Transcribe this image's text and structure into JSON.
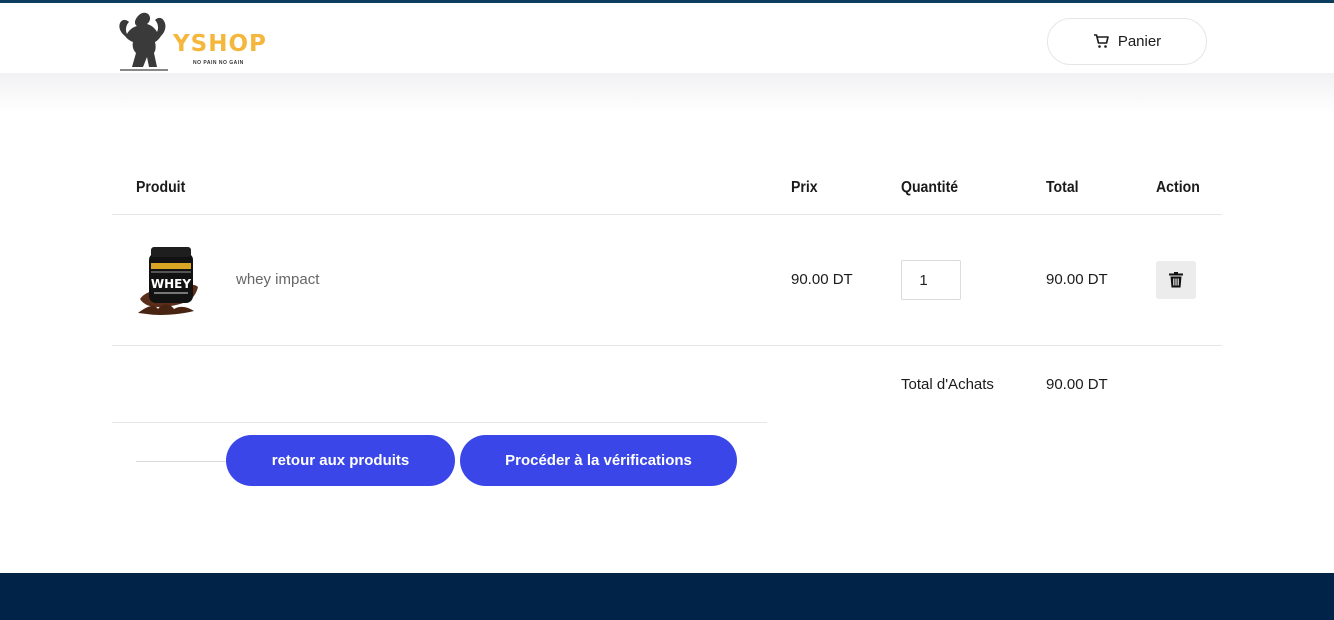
{
  "header": {
    "logo_text": "YSHOP",
    "logo_tagline": "NO PAIN NO GAIN",
    "cart_label": "Panier",
    "cart_icon": "cart-icon"
  },
  "table": {
    "columns": [
      "Produit",
      "Prix",
      "Quantité",
      "Total",
      "Action"
    ],
    "rows": [
      {
        "product": "whey impact",
        "product_image_label": "WHEY",
        "price": "90.00 DT",
        "quantity": "1",
        "total": "90.00 DT",
        "action_icon": "trash-icon"
      }
    ]
  },
  "summary": {
    "label": "Total d'Achats",
    "value": "90.00 DT"
  },
  "actions": {
    "back_label": "retour aux produits",
    "checkout_label": "Procéder à la vérifications"
  },
  "colors": {
    "accent": "#3a46e8",
    "logo": "#f4b73b",
    "footer": "#012348",
    "topbar": "#0c3c5e"
  }
}
